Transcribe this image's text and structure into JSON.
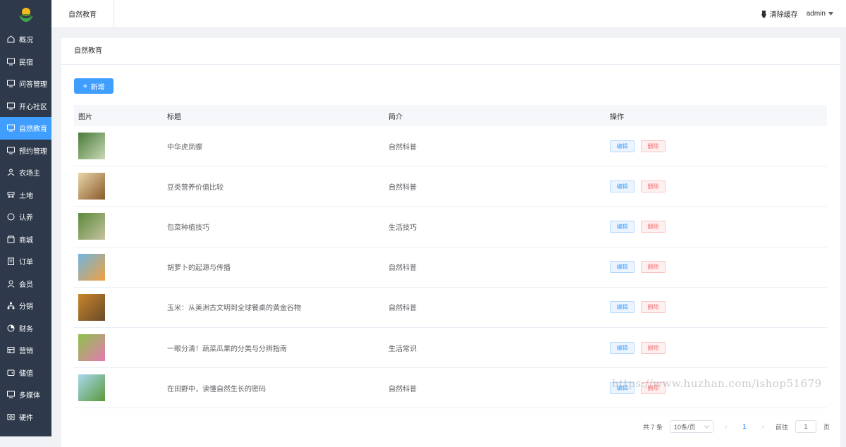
{
  "sidebar": {
    "items": [
      {
        "label": "概况",
        "icon": "home-icon"
      },
      {
        "label": "民宿",
        "icon": "monitor-icon"
      },
      {
        "label": "问答管理",
        "icon": "monitor-icon"
      },
      {
        "label": "开心社区",
        "icon": "monitor-icon"
      },
      {
        "label": "自然教育",
        "icon": "monitor-icon",
        "active": true
      },
      {
        "label": "预约管理",
        "icon": "monitor-icon"
      },
      {
        "label": "农场主",
        "icon": "user-group-icon"
      },
      {
        "label": "土地",
        "icon": "land-icon"
      },
      {
        "label": "认养",
        "icon": "circle-icon"
      },
      {
        "label": "商城",
        "icon": "shop-icon"
      },
      {
        "label": "订单",
        "icon": "order-icon"
      },
      {
        "label": "会员",
        "icon": "user-icon"
      },
      {
        "label": "分销",
        "icon": "share-tree-icon"
      },
      {
        "label": "财务",
        "icon": "pie-icon"
      },
      {
        "label": "营销",
        "icon": "marketing-icon"
      },
      {
        "label": "储值",
        "icon": "wallet-icon"
      },
      {
        "label": "多媒体",
        "icon": "monitor-icon"
      },
      {
        "label": "硬件",
        "icon": "hardware-icon"
      }
    ]
  },
  "topbar": {
    "tab": "自然教育",
    "clear_cache": "清除缓存",
    "user": "admin"
  },
  "breadcrumb": "自然教育",
  "toolbar": {
    "add_label": "新增"
  },
  "table": {
    "headers": [
      "图片",
      "标题",
      "简介",
      "操作"
    ],
    "rows": [
      {
        "title": "中华虎凤蝶",
        "intro": "自然科普",
        "thumb_colors": [
          "#4a7a3a",
          "#c9d9b6"
        ]
      },
      {
        "title": "豆类营养价值比较",
        "intro": "自然科普",
        "thumb_colors": [
          "#e9d6a8",
          "#8a5a2a"
        ]
      },
      {
        "title": "包菜种植技巧",
        "intro": "生活技巧",
        "thumb_colors": [
          "#5a8a3a",
          "#c7c2a0"
        ]
      },
      {
        "title": "胡萝卜的起源与传播",
        "intro": "自然科普",
        "thumb_colors": [
          "#6fb6e0",
          "#f0a040"
        ]
      },
      {
        "title": "玉米：从美洲古文明到全球餐桌的黄金谷物",
        "intro": "自然科普",
        "thumb_colors": [
          "#c8852a",
          "#6a4a2a"
        ]
      },
      {
        "title": "一眼分清！蔬菜瓜果的分类与分辨指南",
        "intro": "生活常识",
        "thumb_colors": [
          "#8bc34a",
          "#e57ab0"
        ]
      },
      {
        "title": "在田野中，读懂自然生长的密码",
        "intro": "自然科普",
        "thumb_colors": [
          "#a8d8f0",
          "#5a9a3a"
        ]
      }
    ],
    "edit_label": "编辑",
    "delete_label": "删除"
  },
  "pagination": {
    "total": "共 7 条",
    "page_size": "10条/页",
    "current_page": "1",
    "goto_label": "前往",
    "goto_value": "1",
    "page_suffix": "页"
  },
  "watermark": "https://www.huzhan.com/ishop51679",
  "colors": {
    "sidebar_bg": "#2e3a4b",
    "accent": "#409eff",
    "danger": "#f56c6c"
  }
}
